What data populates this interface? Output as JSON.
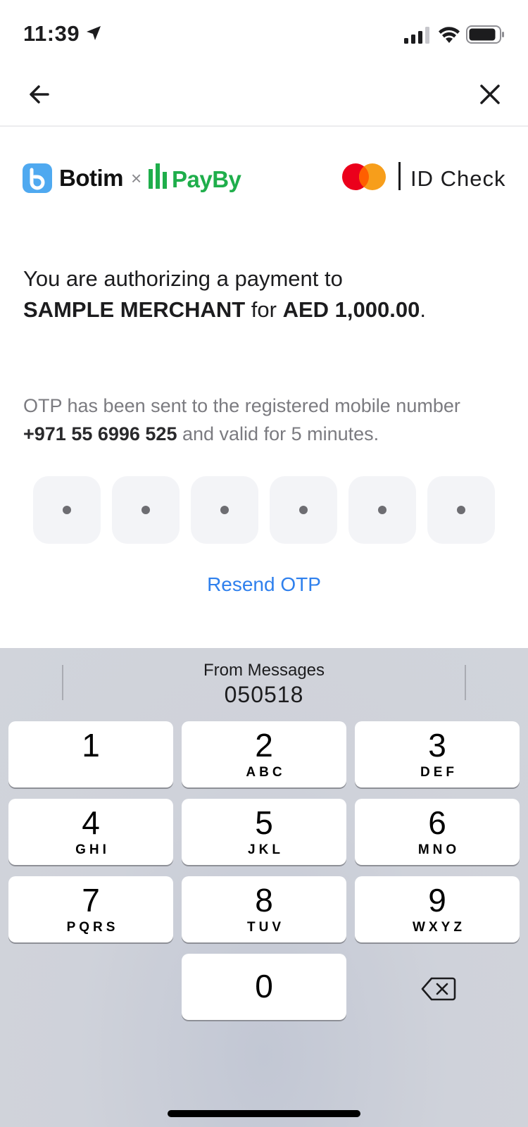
{
  "status_bar": {
    "time": "11:39",
    "location_icon": "location-arrow-icon",
    "signal_icon": "cellular-signal-icon",
    "wifi_icon": "wifi-icon",
    "battery_icon": "battery-icon"
  },
  "nav": {
    "back_icon": "back-arrow-icon",
    "close_icon": "close-icon"
  },
  "brand": {
    "botim_name": "Botim",
    "times_sign": "×",
    "payby_name": "PayBy",
    "id_check_label": "ID Check",
    "colors": {
      "botim_blue": "#4fa9f0",
      "payby_green": "#1fae4b",
      "mastercard_red": "#eb001b",
      "mastercard_orange": "#f79e1b"
    }
  },
  "payment": {
    "intro": "You are authorizing a payment to",
    "merchant": "SAMPLE MERCHANT",
    "for_word": "for",
    "amount": "AED 1,000.00",
    "period": "."
  },
  "otp": {
    "info_prefix": "OTP has been sent to the registered mobile number",
    "phone": "+971 55 6996 525",
    "info_suffix": "and valid for 5 minutes.",
    "digit_count": 6,
    "resend_label": "Resend OTP",
    "accent_color": "#2f80ed"
  },
  "keyboard": {
    "suggestion_label": "From Messages",
    "suggestion_code": "050518",
    "keys": [
      {
        "num": "1",
        "letters": ""
      },
      {
        "num": "2",
        "letters": "ABC"
      },
      {
        "num": "3",
        "letters": "DEF"
      },
      {
        "num": "4",
        "letters": "GHI"
      },
      {
        "num": "5",
        "letters": "JKL"
      },
      {
        "num": "6",
        "letters": "MNO"
      },
      {
        "num": "7",
        "letters": "PQRS"
      },
      {
        "num": "8",
        "letters": "TUV"
      },
      {
        "num": "9",
        "letters": "WXYZ"
      },
      {
        "num": "0",
        "letters": ""
      }
    ],
    "delete_icon": "backspace-icon"
  }
}
